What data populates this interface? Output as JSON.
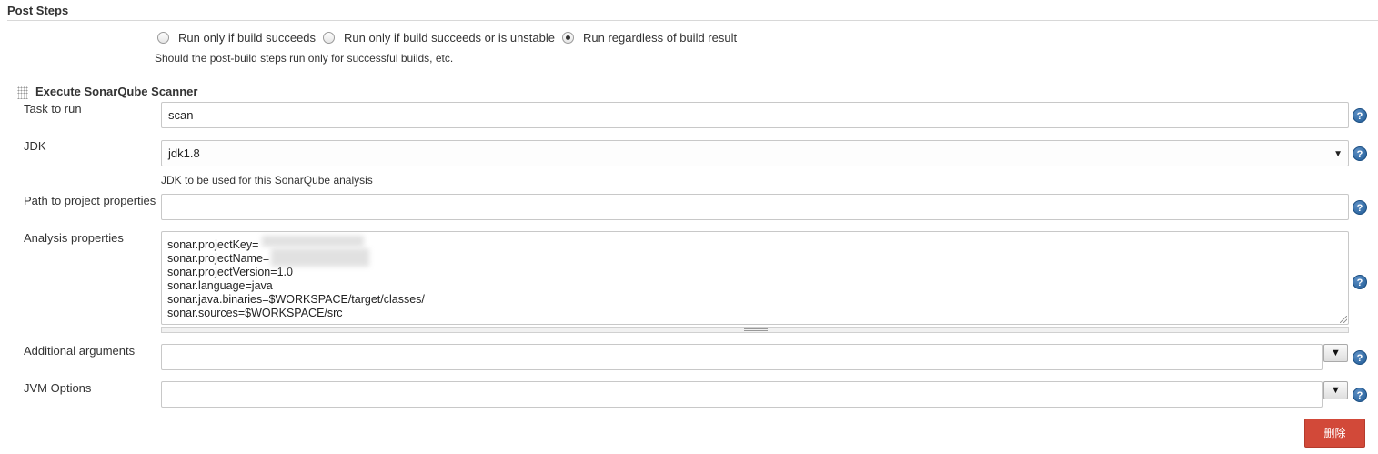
{
  "section": {
    "title": "Post Steps"
  },
  "run_condition": {
    "options": [
      {
        "label": "Run only if build succeeds",
        "checked": false
      },
      {
        "label": "Run only if build succeeds or is unstable",
        "checked": false
      },
      {
        "label": "Run regardless of build result",
        "checked": true
      }
    ],
    "hint": "Should the post-build steps run only for successful builds, etc."
  },
  "builder": {
    "title": "Execute SonarQube Scanner",
    "task": {
      "label": "Task to run",
      "value": "scan"
    },
    "jdk": {
      "label": "JDK",
      "value": "jdk1.8",
      "hint": "JDK to be used for this SonarQube analysis"
    },
    "project_properties": {
      "label": "Path to project properties",
      "value": ""
    },
    "analysis_properties": {
      "label": "Analysis properties",
      "lines": [
        "sonar.projectKey=",
        "sonar.projectName=",
        "sonar.projectVersion=1.0",
        "sonar.language=java",
        "sonar.java.binaries=$WORKSPACE/target/classes/",
        "sonar.sources=$WORKSPACE/src"
      ]
    },
    "additional_arguments": {
      "label": "Additional arguments",
      "value": ""
    },
    "jvm_options": {
      "label": "JVM Options",
      "value": ""
    },
    "delete_label": "删除"
  },
  "icons": {
    "help": "help-icon",
    "expand": "expand-down-icon",
    "select_arrow": "chevron-down-icon",
    "drag": "drag-handle-icon"
  },
  "colors": {
    "delete_button": "#d24939",
    "help_icon": "#2b6aa6"
  }
}
